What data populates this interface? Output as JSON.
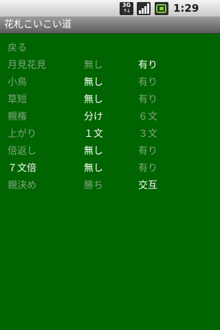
{
  "status_bar": {
    "network": "3G",
    "time": "1:29 PM"
  },
  "title_bar": {
    "title": "花札こいこい道"
  },
  "menu": {
    "back_label": "戻る",
    "rules": [
      {
        "label": "月見花見",
        "opt1": "無し",
        "opt2": "有り",
        "selected": 2
      },
      {
        "label": "小鳥",
        "opt1": "無し",
        "opt2": "有り",
        "selected": 1
      },
      {
        "label": "草短",
        "opt1": "無し",
        "opt2": "有り",
        "selected": 1
      },
      {
        "label": "親権",
        "opt1": "分け",
        "opt2": "６文",
        "selected": 1
      },
      {
        "label": "上がり",
        "opt1": "１文",
        "opt2": "３文",
        "selected": 1
      },
      {
        "label": "倍返し",
        "opt1": "無し",
        "opt2": "有り",
        "selected": 1
      },
      {
        "label": "７文倍",
        "opt1": "無し",
        "opt2": "有り",
        "selected": 1,
        "label_selected": true
      },
      {
        "label": "親決め",
        "opt1": "勝ち",
        "opt2": "交互",
        "selected": 2
      }
    ]
  },
  "colors": {
    "background": "#006400",
    "dim_text": "#7fa67f",
    "selected_text": "#ffffff"
  }
}
